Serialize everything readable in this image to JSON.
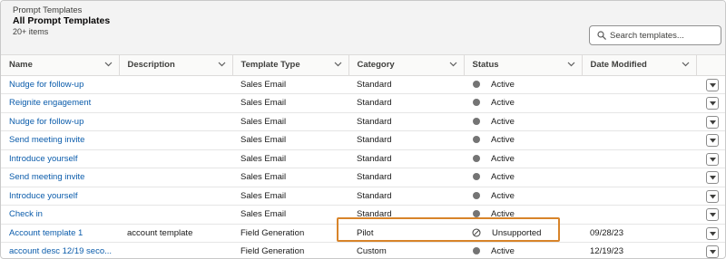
{
  "header": {
    "breadcrumb": "Prompt Templates",
    "title": "All Prompt Templates",
    "item_count": "20+ items"
  },
  "search": {
    "placeholder": "Search templates..."
  },
  "columns": [
    "Name",
    "Description",
    "Template Type",
    "Category",
    "Status",
    "Date Modified"
  ],
  "rows": [
    {
      "name": "Nudge for follow-up",
      "description": "",
      "type": "Sales Email",
      "category": "Standard",
      "status": "Active",
      "status_icon": "dot-icon",
      "date": ""
    },
    {
      "name": "Reignite engagement",
      "description": "",
      "type": "Sales Email",
      "category": "Standard",
      "status": "Active",
      "status_icon": "dot-icon",
      "date": ""
    },
    {
      "name": "Nudge for follow-up",
      "description": "",
      "type": "Sales Email",
      "category": "Standard",
      "status": "Active",
      "status_icon": "dot-icon",
      "date": ""
    },
    {
      "name": "Send meeting invite",
      "description": "",
      "type": "Sales Email",
      "category": "Standard",
      "status": "Active",
      "status_icon": "dot-icon",
      "date": ""
    },
    {
      "name": "Introduce yourself",
      "description": "",
      "type": "Sales Email",
      "category": "Standard",
      "status": "Active",
      "status_icon": "dot-icon",
      "date": ""
    },
    {
      "name": "Send meeting invite",
      "description": "",
      "type": "Sales Email",
      "category": "Standard",
      "status": "Active",
      "status_icon": "dot-icon",
      "date": ""
    },
    {
      "name": "Introduce yourself",
      "description": "",
      "type": "Sales Email",
      "category": "Standard",
      "status": "Active",
      "status_icon": "dot-icon",
      "date": ""
    },
    {
      "name": "Check in",
      "description": "",
      "type": "Sales Email",
      "category": "Standard",
      "status": "Active",
      "status_icon": "dot-icon",
      "date": ""
    },
    {
      "name": "Account template 1",
      "description": "account template",
      "type": "Field Generation",
      "category": "Pilot",
      "status": "Unsupported",
      "status_icon": "ban-icon",
      "date": "09/28/23"
    },
    {
      "name": "account desc 12/19 seco...",
      "description": "",
      "type": "Field Generation",
      "category": "Custom",
      "status": "Active",
      "status_icon": "dot-icon",
      "date": "12/19/23"
    }
  ],
  "colors": {
    "link": "#0b5cab",
    "highlight": "#d8842a",
    "status_dot": "#747474"
  }
}
